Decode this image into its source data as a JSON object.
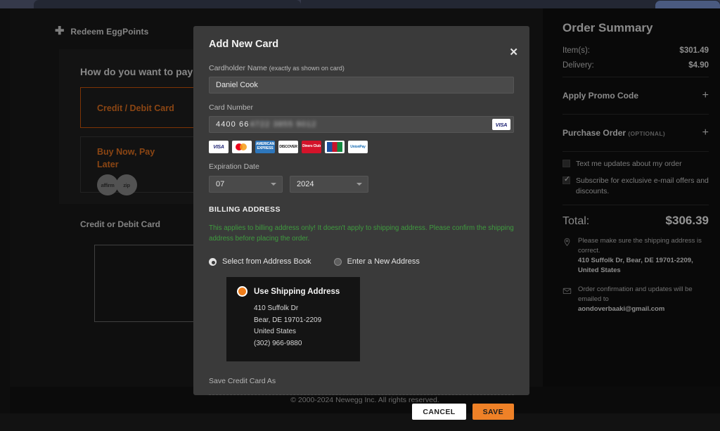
{
  "left": {
    "redeem_label": "Redeem EggPoints",
    "pay_question": "How do you want to pay?",
    "tiles": [
      {
        "title": "Credit / Debit Card"
      },
      {
        "title": "Buy Now, Pay Later"
      }
    ],
    "bnpl_logos": [
      "affirm",
      "zip"
    ],
    "credit_or_debit_label": "Credit or Debit Card"
  },
  "modal": {
    "title": "Add New Card",
    "close_label": "✕",
    "cardholder": {
      "label": "Cardholder Name",
      "label_sub": "(exactly as shown on card)",
      "value": "Daniel Cook",
      "placeholder": "Cardholder Name"
    },
    "card_number": {
      "label": "Card Number",
      "visible": "4400 66",
      "masked": "4722 3855 9012",
      "brand_badge": "VISA",
      "placeholder": "Card Number"
    },
    "accepted_brands": [
      {
        "name": "visa",
        "text": "VISA"
      },
      {
        "name": "mastercard",
        "text": ""
      },
      {
        "name": "amex",
        "text": "AMERICAN EXPRESS"
      },
      {
        "name": "discover",
        "text": "DISCOVER"
      },
      {
        "name": "diners",
        "text": "Diners Club"
      },
      {
        "name": "jcb",
        "text": ""
      },
      {
        "name": "unionpay",
        "text": "UnionPay"
      }
    ],
    "expiration": {
      "label": "Expiration Date",
      "month": "07",
      "year": "2024"
    },
    "billing": {
      "heading": "BILLING ADDRESS",
      "warning": "This applies to billing address only! It doesn't apply to shipping address. Please confirm the shipping address before placing the order.",
      "warning_color": "#3f9c3f",
      "option_select": "Select from Address Book",
      "option_new": "Enter a New Address",
      "selected_mode": "select"
    },
    "address_card": {
      "title": "Use Shipping Address",
      "line1": "410 Suffolk Dr",
      "line2": "Bear, DE 19701-2209",
      "line3": "United States",
      "line4": "(302) 966-9880"
    },
    "save_as_label": "Save Credit Card As",
    "cancel_label": "CANCEL",
    "save_label": "SAVE",
    "accent_color": "#ef8127"
  },
  "order_summary": {
    "title": "Order Summary",
    "lines": [
      {
        "key": "Item(s):",
        "value": "$301.49"
      },
      {
        "key": "Delivery:",
        "value": "$4.90"
      }
    ],
    "promo": {
      "label": "Apply Promo Code",
      "toggle": "+"
    },
    "purchase_order": {
      "label": "Purchase Order",
      "optional": "(OPTIONAL)",
      "toggle": "+"
    },
    "checkboxes": [
      {
        "label": "Text me updates about my order",
        "checked": false
      },
      {
        "label": "Subscribe for exclusive e-mail offers and discounts.",
        "checked": true
      }
    ],
    "total": {
      "label": "Total:",
      "value": "$306.39"
    },
    "notes": [
      {
        "icon": "location-pin-icon",
        "text": "Please make sure the shipping address is correct.",
        "bold": "410 Suffolk Dr, Bear, DE 19701-2209, United States"
      },
      {
        "icon": "envelope-icon",
        "text": "Order confirmation and updates will be emailed to",
        "bold": "aondoverbaaki@gmail.com"
      }
    ]
  },
  "footer": {
    "copyright": "© 2000-2024 Newegg Inc. All rights reserved."
  }
}
